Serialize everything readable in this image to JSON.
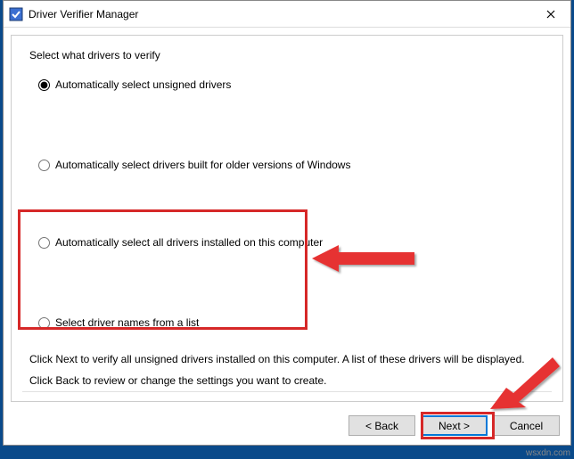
{
  "window": {
    "title": "Driver Verifier Manager"
  },
  "content": {
    "group_label": "Select what drivers to verify",
    "options": {
      "opt1": "Automatically select unsigned drivers",
      "opt2": "Automatically select drivers built for older versions of Windows",
      "opt3": "Automatically select all drivers installed on this computer",
      "opt4": "Select driver names from a list"
    },
    "info_line1": "Click Next to verify all unsigned drivers installed on this computer. A list of these drivers will be displayed.",
    "info_line2": "Click Back to review or change the settings you want to create."
  },
  "buttons": {
    "back": "< Back",
    "next": "Next >",
    "cancel": "Cancel"
  },
  "watermark": "wsxdn.com"
}
